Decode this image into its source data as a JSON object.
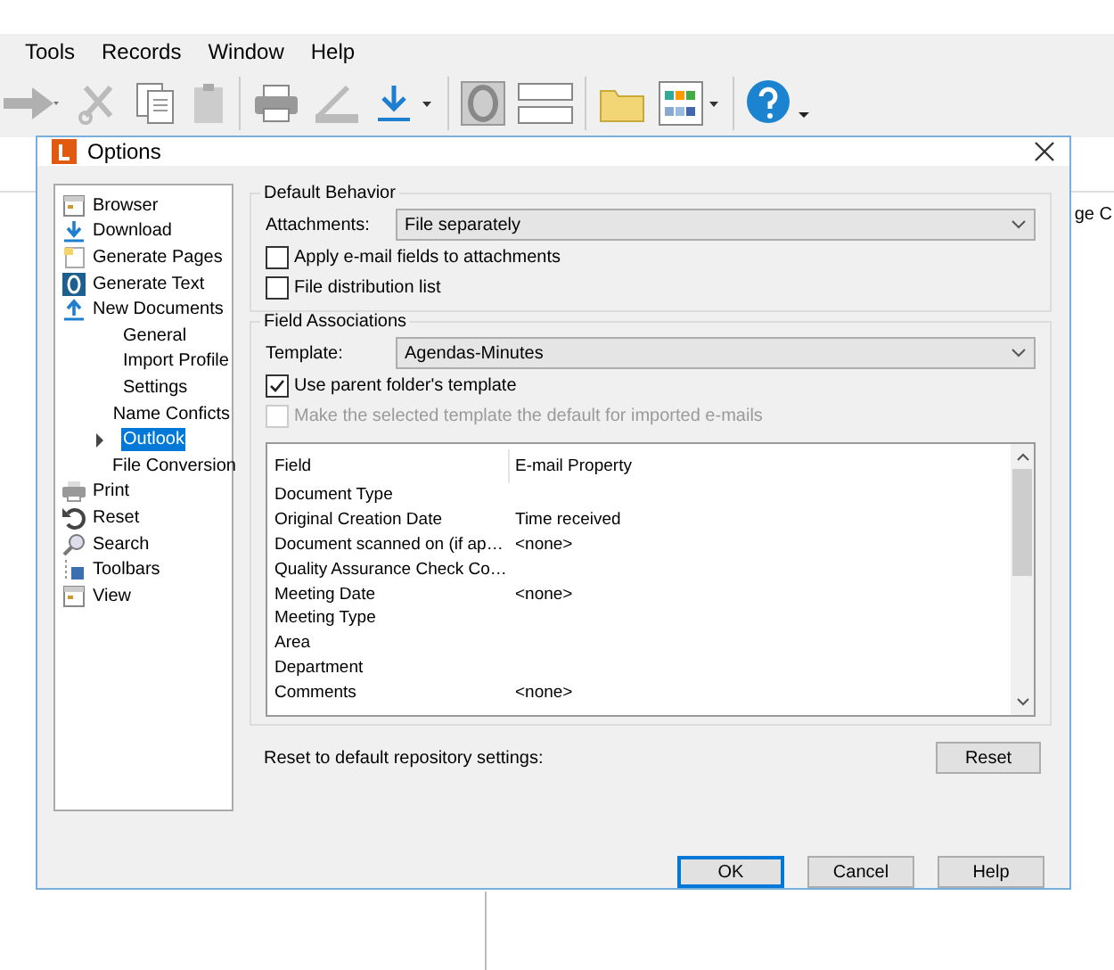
{
  "menu": [
    "Tools",
    "Records",
    "Window",
    "Help"
  ],
  "background_text": "ge C",
  "dialog": {
    "title": "Options",
    "tree": [
      {
        "label": "Browser",
        "selected": false
      },
      {
        "label": "Download",
        "selected": false
      },
      {
        "label": "Generate Pages",
        "selected": false
      },
      {
        "label": "Generate Text",
        "selected": false
      },
      {
        "label": "New Documents",
        "selected": false,
        "children": [
          {
            "label": "General",
            "selected": false,
            "expandable": false
          },
          {
            "label": "Import Profile",
            "selected": false,
            "expandable": false
          },
          {
            "label": "Settings",
            "selected": false,
            "expandable": false
          },
          {
            "label": "Name Conficts",
            "selected": false,
            "expandable": false
          },
          {
            "label": "Outlook",
            "selected": true,
            "expandable": true
          },
          {
            "label": "File Conversion",
            "selected": false,
            "expandable": false
          }
        ]
      },
      {
        "label": "Print",
        "selected": false
      },
      {
        "label": "Reset",
        "selected": false
      },
      {
        "label": "Search",
        "selected": false
      },
      {
        "label": "Toolbars",
        "selected": false
      },
      {
        "label": "View",
        "selected": false
      }
    ],
    "default_behavior": {
      "title": "Default Behavior",
      "attachments_label": "Attachments:",
      "attachments_value": "File separately",
      "checkboxes": [
        {
          "label": "Apply e-mail fields to attachments",
          "checked": false,
          "disabled": false
        },
        {
          "label": "File distribution list",
          "checked": false,
          "disabled": false
        }
      ]
    },
    "field_associations": {
      "title": "Field Associations",
      "template_label": "Template:",
      "template_value": "Agendas-Minutes",
      "checkboxes": [
        {
          "label": "Use parent folder's template",
          "checked": true,
          "disabled": false
        },
        {
          "label": "Make the selected template the default for imported e-mails",
          "checked": false,
          "disabled": true
        }
      ],
      "table": {
        "columns": [
          "Field",
          "E-mail Property"
        ],
        "rows": [
          [
            "Document Type",
            ""
          ],
          [
            "Original Creation Date",
            "Time received"
          ],
          [
            "Document scanned on (if ap…",
            "<none>"
          ],
          [
            "Quality Assurance Check Co…",
            ""
          ],
          [
            "Meeting Date",
            "<none>"
          ],
          [
            "Meeting Type",
            ""
          ],
          [
            "Area",
            ""
          ],
          [
            "Department",
            ""
          ],
          [
            "Comments",
            "<none>"
          ]
        ]
      }
    },
    "reset_label": "Reset to default repository settings:",
    "reset_button": "Reset",
    "buttons": [
      {
        "label": "OK",
        "default": true
      },
      {
        "label": "Cancel",
        "default": false
      },
      {
        "label": "Help",
        "default": false
      }
    ]
  }
}
